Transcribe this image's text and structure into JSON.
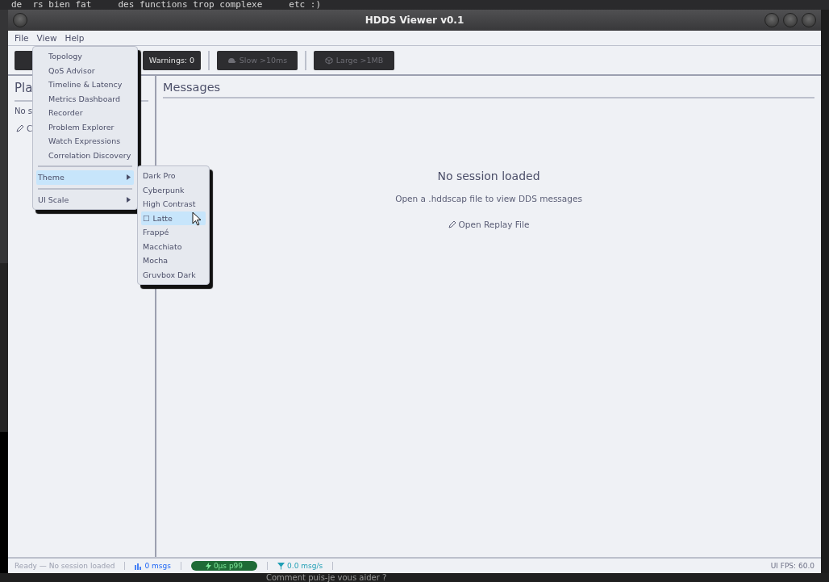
{
  "desktop": {
    "top_text": "de  rs bien fat     des functions trop complexe     etc :)",
    "bottom_text": "Comment puis-je vous aider ?"
  },
  "window": {
    "title": "HDDS Viewer v0.1"
  },
  "menu_bar": [
    "File",
    "View",
    "Help"
  ],
  "toolbar": [
    {
      "label": "Warnings: 0",
      "enabled": true
    },
    {
      "label": "Slow >10ms",
      "enabled": false
    },
    {
      "label": "Large >1MB",
      "enabled": false
    }
  ],
  "sidebar": {
    "title": "Pla",
    "status": "No s",
    "button": "C"
  },
  "messages": {
    "title": "Messages",
    "empty_title": "No session loaded",
    "empty_hint": "Open a .hddscap file to view DDS messages",
    "open_button": "Open Replay File"
  },
  "view_menu": [
    {
      "kind": "item",
      "label": "Topology",
      "highlighted": false
    },
    {
      "kind": "item",
      "label": "QoS Advisor",
      "highlighted": false
    },
    {
      "kind": "item",
      "label": "Timeline & Latency",
      "highlighted": false
    },
    {
      "kind": "item",
      "label": "Metrics Dashboard",
      "highlighted": false
    },
    {
      "kind": "item",
      "label": "Recorder",
      "highlighted": false
    },
    {
      "kind": "item",
      "label": "Problem Explorer",
      "highlighted": false
    },
    {
      "kind": "item",
      "label": "Watch Expressions",
      "highlighted": false
    },
    {
      "kind": "item",
      "label": "Correlation Discovery",
      "highlighted": false
    },
    {
      "kind": "separator"
    },
    {
      "kind": "submenu",
      "label": "Theme",
      "highlighted": true
    },
    {
      "kind": "separator"
    },
    {
      "kind": "submenu",
      "label": "UI Scale",
      "highlighted": false
    }
  ],
  "theme_menu": [
    {
      "label": "Dark Pro",
      "highlighted": false
    },
    {
      "label": "Cyberpunk",
      "highlighted": false
    },
    {
      "label": "High Contrast",
      "highlighted": false
    },
    {
      "label": "Latte",
      "marker": "☐",
      "highlighted": true
    },
    {
      "label": "Frappé",
      "highlighted": false
    },
    {
      "label": "Macchiato",
      "highlighted": false
    },
    {
      "label": "Mocha",
      "highlighted": false
    },
    {
      "label": "Gruvbox Dark",
      "highlighted": false
    }
  ],
  "status_bar": {
    "status": "Ready — No session loaded",
    "messages": "0 msgs",
    "latency": "0µs p99",
    "rate": "0.0 msg/s",
    "fps": "UI FPS: 60.0"
  }
}
